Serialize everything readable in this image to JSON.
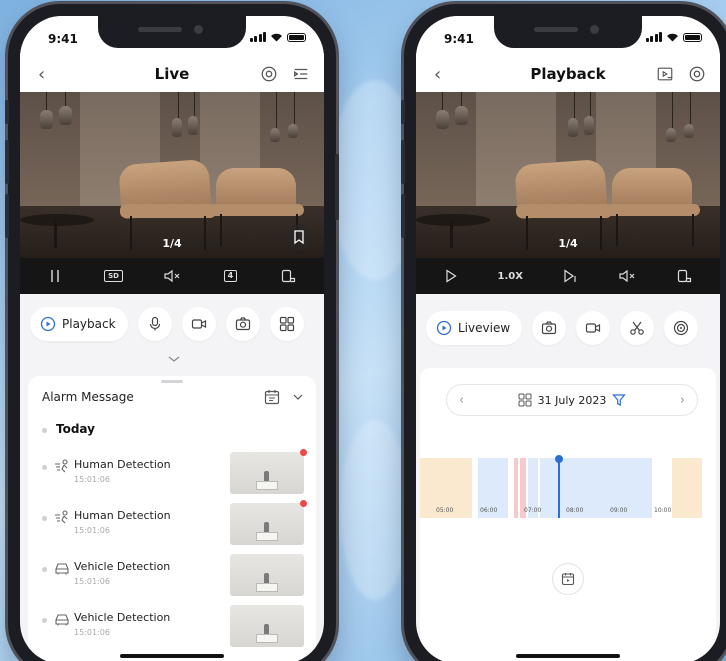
{
  "left_phone": {
    "status": {
      "time": "9:41"
    },
    "nav": {
      "title": "Live"
    },
    "video": {
      "page_indicator": "1/4"
    },
    "toolbar": {
      "sd_label": "SD",
      "split_label": "4"
    },
    "actions": {
      "playback_label": "Playback"
    },
    "alarm": {
      "title": "Alarm Message",
      "group": "Today",
      "items": [
        {
          "name": "Human Detection",
          "time": "15:01:06",
          "icon": "human-detection-icon",
          "unread": true
        },
        {
          "name": "Human Detection",
          "time": "15:01:06",
          "icon": "human-detection-icon",
          "unread": true
        },
        {
          "name": "Vehicle Detection",
          "time": "15:01:06",
          "icon": "vehicle-icon",
          "unread": false
        },
        {
          "name": "Vehicle Detection",
          "time": "15:01:06",
          "icon": "vehicle-icon",
          "unread": false
        }
      ]
    }
  },
  "right_phone": {
    "status": {
      "time": "9:41"
    },
    "nav": {
      "title": "Playback"
    },
    "video": {
      "page_indicator": "1/4"
    },
    "toolbar": {
      "speed_label": "1.0X"
    },
    "actions": {
      "liveview_label": "Liveview"
    },
    "date": "31 July 2023",
    "timeline": {
      "ticks": [
        "05:00",
        "06:00",
        "07:00",
        "08:00",
        "09:00",
        "10:00"
      ]
    }
  },
  "colors": {
    "accent": "#2b6fd6",
    "alert": "#f04747",
    "record_normal": "#dceafc",
    "record_event": "#fbe9cf",
    "record_alarm": "#f7c9c9"
  }
}
